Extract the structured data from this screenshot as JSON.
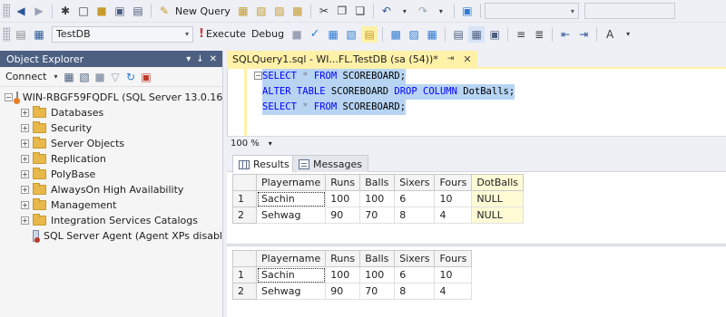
{
  "toolbar1": {
    "new_query_label": "New Query"
  },
  "toolbar2": {
    "database_value": "TestDB",
    "execute_label": "Execute",
    "debug_label": "Debug"
  },
  "object_explorer": {
    "title": "Object Explorer",
    "connect_label": "Connect",
    "server": "WIN-RBGF59FQDFL (SQL Server 13.0.16",
    "items": [
      {
        "label": "Databases",
        "icon": "folder-icon"
      },
      {
        "label": "Security",
        "icon": "folder-icon"
      },
      {
        "label": "Server Objects",
        "icon": "folder-icon"
      },
      {
        "label": "Replication",
        "icon": "folder-icon"
      },
      {
        "label": "PolyBase",
        "icon": "folder-icon"
      },
      {
        "label": "AlwaysOn High Availability",
        "icon": "folder-icon"
      },
      {
        "label": "Management",
        "icon": "folder-icon"
      },
      {
        "label": "Integration Services Catalogs",
        "icon": "folder-icon"
      }
    ],
    "agent": "SQL Server Agent (Agent XPs disabl"
  },
  "document_tab": {
    "label": "SQLQuery1.sql - WI...FL.TestDB (sa (54))*"
  },
  "editor": {
    "lines": [
      {
        "kw": "SELECT",
        "mid": " * ",
        "kw2": "FROM",
        "rest": " SCOREBOARD;"
      },
      {
        "kw": "ALTER TABLE",
        "mid": " SCOREBOARD ",
        "kw2": "DROP COLUMN",
        "rest": " DotBalls;"
      },
      {
        "kw": "SELECT",
        "mid": " * ",
        "kw2": "FROM",
        "rest": " SCOREBOARD;"
      }
    ]
  },
  "zoom": {
    "value": "100 %"
  },
  "results_tabs": {
    "results_label": "Results",
    "messages_label": "Messages"
  },
  "result1": {
    "columns": [
      "Playername",
      "Runs",
      "Balls",
      "Sixers",
      "Fours",
      "DotBalls"
    ],
    "rows": [
      [
        "1",
        "Sachin",
        "100",
        "100",
        "6",
        "10",
        "NULL"
      ],
      [
        "2",
        "Sehwag",
        "90",
        "70",
        "8",
        "4",
        "NULL"
      ]
    ]
  },
  "result2": {
    "columns": [
      "Playername",
      "Runs",
      "Balls",
      "Sixers",
      "Fours"
    ],
    "rows": [
      [
        "1",
        "Sachin",
        "100",
        "100",
        "6",
        "10"
      ],
      [
        "2",
        "Sehwag",
        "90",
        "70",
        "8",
        "4"
      ]
    ]
  }
}
